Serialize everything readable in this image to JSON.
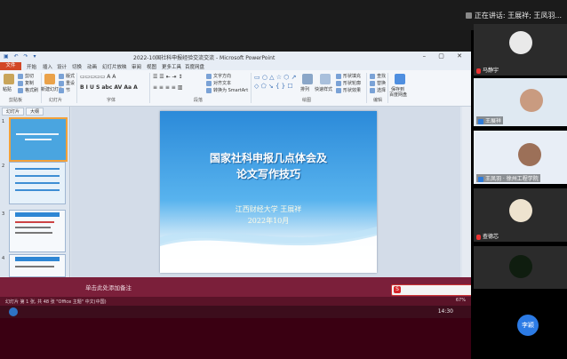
{
  "meeting": {
    "speaking_label": "正在讲话: 王展祥; 王凤羽..."
  },
  "ppt": {
    "window_title": "2022-10国社科申报经验交流交流 - Microsoft PowerPoint",
    "qat": "▣ ↶ ↷ ▾",
    "window_controls": "– ▢ ✕",
    "tabs": {
      "file": "文件",
      "home": "开始",
      "insert": "插入",
      "design": "设计",
      "transitions": "切换",
      "animations": "动画",
      "slideshow": "幻灯片放映",
      "review": "审阅",
      "view": "视图",
      "more": "更多工具",
      "baidu": "百度网盘"
    },
    "ribbon": {
      "paste": "粘贴",
      "cut": "剪切",
      "copy": "复制",
      "format_painter": "格式刷",
      "new_slide": "新建幻灯片",
      "layout": "版式",
      "reset": "重设",
      "section": "节",
      "groups": {
        "clipboard": "剪贴板",
        "slides": "幻灯片",
        "font": "字体",
        "paragraph": "段落",
        "drawing": "绘图",
        "editing": "编辑"
      },
      "text_direction": "文字方向",
      "align_text": "对齐文本",
      "smartart": "转换为 SmartArt",
      "arrange": "排列",
      "quick_styles": "快速样式",
      "shape_fill": "形状填充",
      "shape_outline": "形状轮廓",
      "shape_effects": "形状效果",
      "find": "查找",
      "replace": "替换",
      "select": "选择",
      "save_cloud_1": "保存到",
      "save_cloud_2": "百度网盘"
    },
    "pane_tabs": [
      "幻灯片",
      "大纲"
    ],
    "thumbnails": [
      "1",
      "2",
      "3",
      "4"
    ],
    "slide": {
      "title_line1": "国家社科申报几点体会及",
      "title_line2": "论文写作技巧",
      "author": "江西财经大学  王展祥",
      "date": "2022年10月"
    },
    "notes_placeholder": "单击此处添加备注",
    "status_left": "幻灯片 第 1 张, 共 48 张   \"Office 主题\"   中文(中国)",
    "status_right": "67%",
    "clock": "14:30"
  },
  "participants": [
    {
      "name": "马静宇"
    },
    {
      "name": "王展祥"
    },
    {
      "name": "王凤羽 · 徐州工程学院"
    },
    {
      "name": "查德芯"
    },
    {
      "name": ""
    }
  ],
  "floating_avatar": "李颖",
  "colors": {
    "file_tab": "#d24726",
    "slide_blue": "#2b8ad9",
    "notes_bg": "#7b1f3a",
    "avatar_blue": "#2c7be5"
  }
}
